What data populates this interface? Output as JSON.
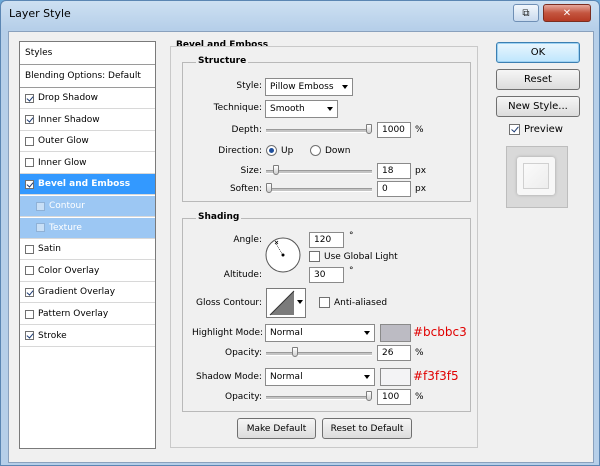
{
  "window": {
    "title": "Layer Style",
    "controls": {
      "restore": "⧉",
      "close": "✕"
    }
  },
  "styles_panel": {
    "header": "Styles",
    "blending_options": "Blending Options: Default",
    "items": [
      {
        "label": "Drop Shadow",
        "checked": true
      },
      {
        "label": "Inner Shadow",
        "checked": true
      },
      {
        "label": "Outer Glow",
        "checked": false
      },
      {
        "label": "Inner Glow",
        "checked": false
      },
      {
        "label": "Bevel and Emboss",
        "checked": true
      },
      {
        "label": "Contour",
        "checked": false
      },
      {
        "label": "Texture",
        "checked": false
      },
      {
        "label": "Satin",
        "checked": false
      },
      {
        "label": "Color Overlay",
        "checked": false
      },
      {
        "label": "Gradient Overlay",
        "checked": true
      },
      {
        "label": "Pattern Overlay",
        "checked": false
      },
      {
        "label": "Stroke",
        "checked": true
      }
    ]
  },
  "bevel": {
    "section_title": "Bevel and Emboss",
    "structure": {
      "title": "Structure",
      "style_label": "Style:",
      "style_value": "Pillow Emboss",
      "technique_label": "Technique:",
      "technique_value": "Smooth",
      "depth_label": "Depth:",
      "depth_value": "1000",
      "depth_unit": "%",
      "depth_fraction": 1.0,
      "direction_label": "Direction:",
      "direction_up": "Up",
      "direction_down": "Down",
      "direction_selected": "Up",
      "size_label": "Size:",
      "size_value": "18",
      "size_unit": "px",
      "size_fraction": 0.07,
      "soften_label": "Soften:",
      "soften_value": "0",
      "soften_unit": "px",
      "soften_fraction": 0.0
    },
    "shading": {
      "title": "Shading",
      "angle_label": "Angle:",
      "angle_value": "120",
      "degree_symbol": "°",
      "use_global_light": "Use Global Light",
      "use_global_light_checked": false,
      "altitude_label": "Altitude:",
      "altitude_value": "30",
      "gloss_contour_label": "Gloss Contour:",
      "anti_aliased": "Anti-aliased",
      "anti_aliased_checked": false,
      "highlight_mode_label": "Highlight Mode:",
      "highlight_mode_value": "Normal",
      "highlight_color": "#bcbbc3",
      "highlight_opacity_label": "Opacity:",
      "highlight_opacity_value": "26",
      "highlight_opacity_fraction": 0.26,
      "shadow_mode_label": "Shadow Mode:",
      "shadow_mode_value": "Normal",
      "shadow_color": "#f3f3f5",
      "shadow_opacity_label": "Opacity:",
      "shadow_opacity_value": "100",
      "shadow_opacity_fraction": 1.0,
      "percent": "%"
    },
    "make_default": "Make Default",
    "reset_to_default": "Reset to Default"
  },
  "annotations": {
    "highlight_hex": "#bcbbc3",
    "shadow_hex": "#f3f3f5"
  },
  "actions": {
    "ok": "OK",
    "reset": "Reset",
    "new_style": "New Style...",
    "preview": "Preview",
    "preview_checked": true
  }
}
